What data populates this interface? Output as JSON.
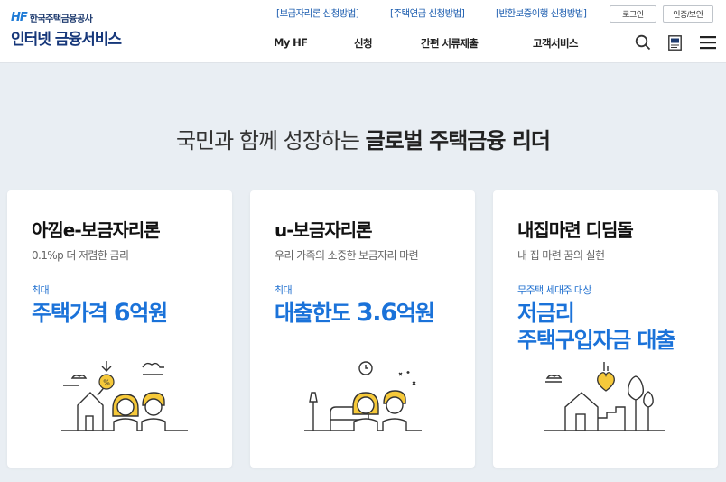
{
  "header": {
    "logo_mark": "HF",
    "logo_org": "한국주택금융공사",
    "logo_title": "인터넷 금융서비스",
    "util_links": [
      "[보금자리론 신청방법]",
      "[주택연금 신청방법]",
      "[반환보증이행 신청방법]"
    ],
    "login_label": "로그인",
    "cert_label": "인증/보안",
    "nav": [
      "My HF",
      "신청",
      "간편 서류제출",
      "고객서비스"
    ],
    "icons": [
      "search-icon",
      "hf-document-icon",
      "menu-icon"
    ]
  },
  "slogan": {
    "light": "국민과 함께 성장하는 ",
    "bold": "글로벌 주택금융 리더"
  },
  "cards": [
    {
      "title": "아낌e-보금자리론",
      "subtitle": "0.1%p 더 저렴한 금리",
      "tag": "최대",
      "headline_pre": "주택가격 ",
      "headline_num": "6",
      "headline_post": "억원"
    },
    {
      "title": "u-보금자리론",
      "subtitle": "우리 가족의 소중한 보금자리 마련",
      "tag": "최대",
      "headline_pre": "대출한도 ",
      "headline_num": "3.6",
      "headline_post": "억원"
    },
    {
      "title": "내집마련 디딤돌",
      "subtitle": "내 집 마련 꿈의 실현",
      "tag": "무주택 세대주 대상",
      "headline_line1": "저금리",
      "headline_line2": "주택구입자금 대출"
    }
  ],
  "colors": {
    "brand_navy": "#16377a",
    "accent_blue": "#1a72d9",
    "illustration_yellow": "#f6c93a",
    "page_bg": "#e9eef3"
  }
}
